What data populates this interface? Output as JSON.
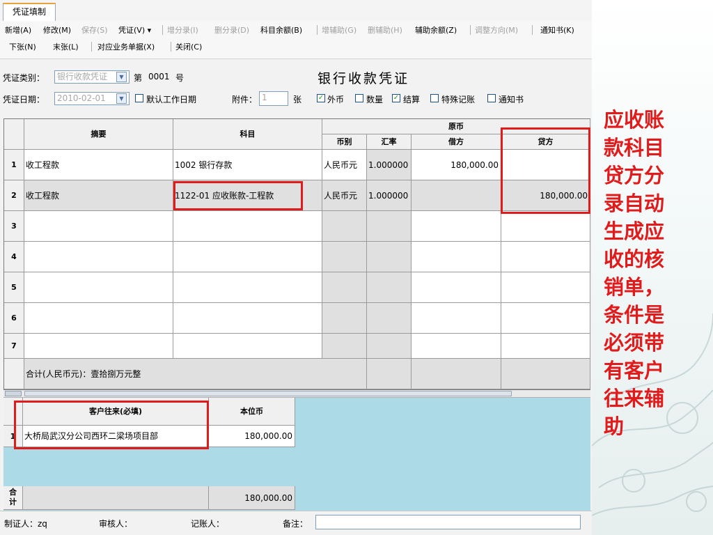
{
  "tab": {
    "label": "凭证填制"
  },
  "toolbar": {
    "row1": [
      {
        "label": "新增(A)",
        "enabled": true
      },
      {
        "label": "修改(M)",
        "enabled": true
      },
      {
        "label": "保存(S)",
        "enabled": false
      },
      {
        "label": "凭证(V) ▾",
        "enabled": true
      },
      {
        "label": "增分录(I)",
        "enabled": false
      },
      {
        "label": "删分录(D)",
        "enabled": false
      },
      {
        "label": "科目余额(B)",
        "enabled": true
      },
      {
        "label": "增辅助(G)",
        "enabled": false
      },
      {
        "label": "删辅助(H)",
        "enabled": false
      },
      {
        "label": "辅助余额(Z)",
        "enabled": true
      },
      {
        "label": "调整方向(M)",
        "enabled": false
      },
      {
        "label": "通知书(K)",
        "enabled": true
      }
    ],
    "row2": [
      {
        "label": "下张(N)",
        "enabled": true
      },
      {
        "label": "末张(L)",
        "enabled": true
      },
      {
        "label": "对应业务单据(X)",
        "enabled": true
      },
      {
        "label": "关闭(C)",
        "enabled": true
      }
    ]
  },
  "form": {
    "voucher_type_label": "凭证类别：",
    "voucher_type_value": "银行收款凭证",
    "number_prefix": "第",
    "number_value": "0001",
    "number_suffix": "号",
    "title": "银行收款凭证",
    "date_label": "凭证日期：",
    "date_value": "2010-02-01",
    "default_date_label": "默认工作日期",
    "attach_label": "附件：",
    "attach_value": "1",
    "attach_unit": "张",
    "foreign_label": "外币",
    "quantity_label": "数量",
    "settle_label": "结算",
    "special_label": "特殊记账",
    "notice_label": "通知书"
  },
  "grid": {
    "headers": {
      "summary": "摘要",
      "account": "科目",
      "original": "原币",
      "currency": "币别",
      "rate": "汇率",
      "debit": "借方",
      "credit": "贷方"
    },
    "rows": [
      {
        "no": "1",
        "summary": "收工程款",
        "account": "1002 银行存款",
        "currency": "人民币元",
        "rate": "1.000000",
        "debit": "180,000.00",
        "credit": ""
      },
      {
        "no": "2",
        "summary": "收工程款",
        "account": "1122-01 应收账款-工程款",
        "currency": "人民币元",
        "rate": "1.000000",
        "debit": "",
        "credit": "180,000.00"
      },
      {
        "no": "3",
        "summary": "",
        "account": "",
        "currency": "",
        "rate": "",
        "debit": "",
        "credit": ""
      },
      {
        "no": "4",
        "summary": "",
        "account": "",
        "currency": "",
        "rate": "",
        "debit": "",
        "credit": ""
      },
      {
        "no": "5",
        "summary": "",
        "account": "",
        "currency": "",
        "rate": "",
        "debit": "",
        "credit": ""
      },
      {
        "no": "6",
        "summary": "",
        "account": "",
        "currency": "",
        "rate": "",
        "debit": "",
        "credit": ""
      },
      {
        "no": "7",
        "summary": "",
        "account": "",
        "currency": "",
        "rate": "",
        "debit": "",
        "credit": ""
      }
    ],
    "total_label": "合计(人民币元)：壹拾捌万元整"
  },
  "aux": {
    "header_customer": "客户往来(必填)",
    "header_amount": "本位币",
    "row_no": "1",
    "customer": "大桥局武汉分公司西环二梁场项目部",
    "amount": "180,000.00",
    "total_label": "合\n计",
    "total_amount": "180,000.00"
  },
  "status": {
    "maker": "制证人：zq",
    "reviewer": "审核人：",
    "bookkeeper": "记账人：",
    "remark": "备注："
  },
  "annotation": "应收账款科目贷方分录自动生成应收的核销单，条件是必须带有客户往来辅助",
  "colors": {
    "highlight": "#e11b1b",
    "grid_bg": "#acdae6"
  }
}
